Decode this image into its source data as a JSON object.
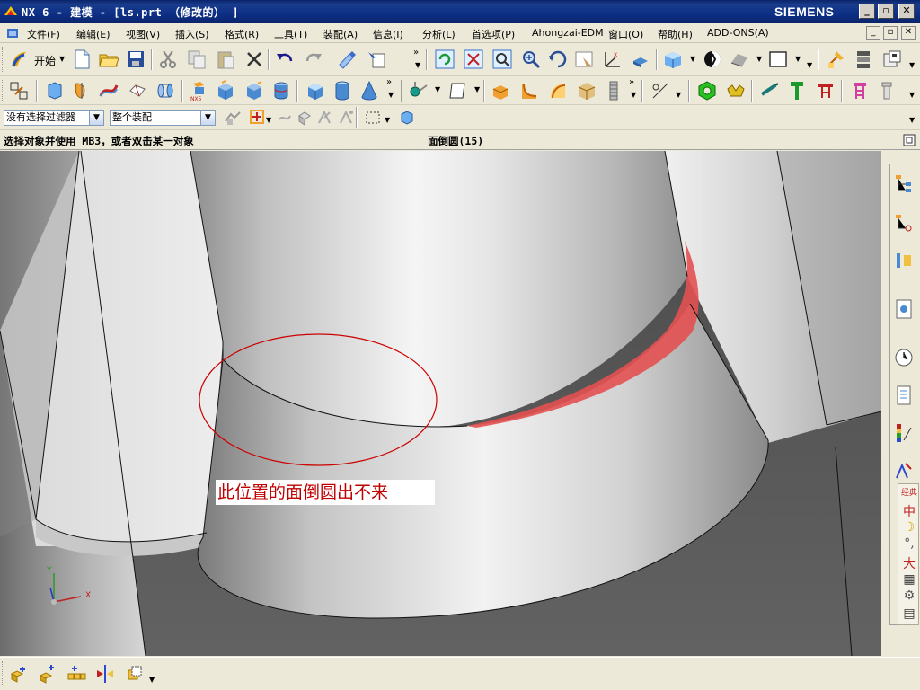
{
  "window": {
    "title": "NX 6 - 建模 - [ls.prt （修改的） ]",
    "brand": "SIEMENS",
    "controls": {
      "minimize": "_",
      "restore": "▫",
      "close": "✕"
    }
  },
  "menu": {
    "items": [
      {
        "label": "文件(F)"
      },
      {
        "label": "编辑(E)"
      },
      {
        "label": "视图(V)"
      },
      {
        "label": "插入(S)"
      },
      {
        "label": "格式(R)"
      },
      {
        "label": "工具(T)"
      },
      {
        "label": "装配(A)"
      },
      {
        "label": "信息(I)"
      },
      {
        "label": "分析(L)"
      },
      {
        "label": "首选项(P)"
      },
      {
        "label": "Ahongzai-EDM"
      },
      {
        "label": "窗口(O)"
      },
      {
        "label": "帮助(H)"
      },
      {
        "label": "ADD-ONS(A)"
      }
    ],
    "mdi_controls": {
      "minimize": "_",
      "restore": "▫",
      "close": "✕"
    }
  },
  "toolbar_standard": {
    "start_label": "开始"
  },
  "selection_bar": {
    "filter_value": "没有选择过滤器",
    "scope_value": "整个装配"
  },
  "status": {
    "prompt": "选择对象并使用 MB3，或者双击某一对象",
    "selection": "面倒圆(15)"
  },
  "viewport": {
    "annotation_text": "此位置的面倒圆出不来",
    "annotation_color": "#cc0000",
    "highlight_color": "#e35050",
    "axis": {
      "x": "X",
      "y": "Y"
    }
  },
  "ime": {
    "items": [
      "经典",
      "中",
      "☽",
      "°,",
      "大",
      "▦",
      "⚙",
      "▤"
    ]
  }
}
